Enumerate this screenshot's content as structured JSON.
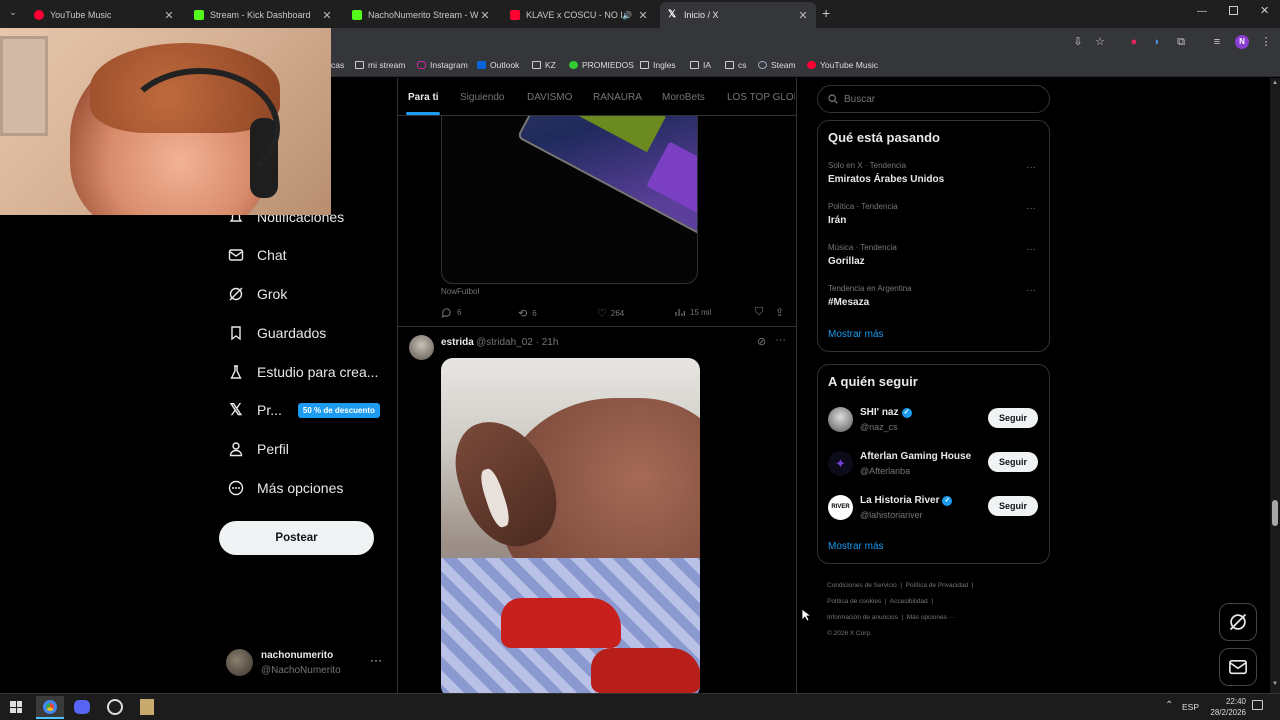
{
  "browser": {
    "tabs": [
      {
        "title": "YouTube Music",
        "color": "#ff0033"
      },
      {
        "title": "Stream - Kick Dashboard",
        "color": "#53fc18"
      },
      {
        "title": "NachoNumerito Stream - Watch",
        "color": "#53fc18"
      },
      {
        "title": "KLAVE x COSCU - NO LO SE",
        "color": "#ff0033"
      },
      {
        "title": "Inicio / X",
        "color": "#ffffff"
      }
    ],
    "new_tab_label": "+",
    "bookmarks": [
      {
        "label": "cas"
      },
      {
        "label": "mi stream"
      },
      {
        "label": "Instagram"
      },
      {
        "label": "Outlook"
      },
      {
        "label": "KZ"
      },
      {
        "label": "PROMIEDOS"
      },
      {
        "label": "Ingles"
      },
      {
        "label": "IA"
      },
      {
        "label": "cs"
      },
      {
        "label": "Steam"
      },
      {
        "label": "YouTube Music"
      }
    ],
    "profile_initial": "N"
  },
  "sidebar": {
    "items": [
      {
        "label": "Notificaciones",
        "icon": "bell-icon"
      },
      {
        "label": "Chat",
        "icon": "mail-icon"
      },
      {
        "label": "Grok",
        "icon": "grok-icon"
      },
      {
        "label": "Guardados",
        "icon": "bookmark-icon"
      },
      {
        "label": "Estudio para crea...",
        "icon": "creator-studio-icon"
      },
      {
        "label": "Pr...",
        "icon": "x-logo-icon"
      },
      {
        "label": "Perfil",
        "icon": "person-icon"
      },
      {
        "label": "Más opciones",
        "icon": "more-circle-icon"
      }
    ],
    "premium_badge": "50 % de descuento",
    "post_button": "Postear",
    "account": {
      "name": "nachonumerito",
      "handle": "@NachoNumerito"
    }
  },
  "feed": {
    "tabs": [
      {
        "label": "Para ti",
        "active": true
      },
      {
        "label": "Siguiendo"
      },
      {
        "label": "DAVISMO"
      },
      {
        "label": "RANAURA"
      },
      {
        "label": "MoroBets"
      },
      {
        "label": "LOS TOP GLOBA"
      }
    ],
    "post1": {
      "source": "NowFutbol",
      "replies": "6",
      "reposts": "6",
      "likes": "264",
      "views": "15 mil"
    },
    "post2": {
      "name": "estrida",
      "meta": "@stridah_02 · 21h"
    }
  },
  "right": {
    "search_placeholder": "Buscar",
    "trends": {
      "title": "Qué está pasando",
      "items": [
        {
          "context": "Solo en X · Tendencia",
          "name": "Emiratos Árabes Unidos"
        },
        {
          "context": "Política · Tendencia",
          "name": "Irán"
        },
        {
          "context": "Música · Tendencia",
          "name": "Gorillaz"
        },
        {
          "context": "Tendencia en Argentina",
          "name": "#Mesaza"
        }
      ],
      "more": "Mostrar más"
    },
    "follow": {
      "title": "A quién seguir",
      "items": [
        {
          "name": "SHI' naz",
          "handle": "@naz_cs",
          "verified": true
        },
        {
          "name": "Afterlan Gaming House",
          "handle": "@Afterlanba",
          "verified": false
        },
        {
          "name": "La Historia River",
          "handle": "@lahistoriariver",
          "verified": true
        }
      ],
      "follow_label": "Seguir",
      "more": "Mostrar más"
    },
    "footer": {
      "links": [
        "Condiciones de Servicio",
        "Política de Privacidad",
        "Política de cookies",
        "Accesibilidad",
        "Información de anuncios",
        "Más opciones ···"
      ],
      "copyright": "© 2026 X Corp."
    }
  },
  "taskbar": {
    "lang": "ESP",
    "time": "22:40",
    "date": "28/2/2026"
  }
}
